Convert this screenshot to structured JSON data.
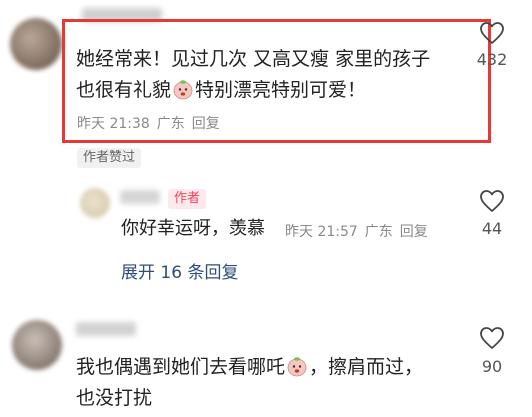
{
  "comments": [
    {
      "text_line1": "她经常来！见过几次 又高又瘦 家里的孩子",
      "text_line2_before": "也很有礼貌",
      "text_line2_after": "特别漂亮特别可爱！",
      "time": "昨天 21:38",
      "location": "广东",
      "reply_label": "回复",
      "likes": "432",
      "author_liked_badge": "作者赞过",
      "reply": {
        "author_tag": "作者",
        "text": "你好幸运呀，羡慕",
        "time": "昨天 21:57",
        "location": "广东",
        "reply_label": "回复",
        "likes": "44"
      },
      "expand_label": "展开 16 条回复"
    },
    {
      "text_line1_before": "我也偶遇到她们去看哪吒",
      "text_line1_after": "，擦肩而过，",
      "text_line2": "也没打扰",
      "likes": "90"
    }
  ],
  "colors": {
    "highlight": "#e53935",
    "link": "#2e4d7b",
    "author_tag": "#f0455e"
  }
}
